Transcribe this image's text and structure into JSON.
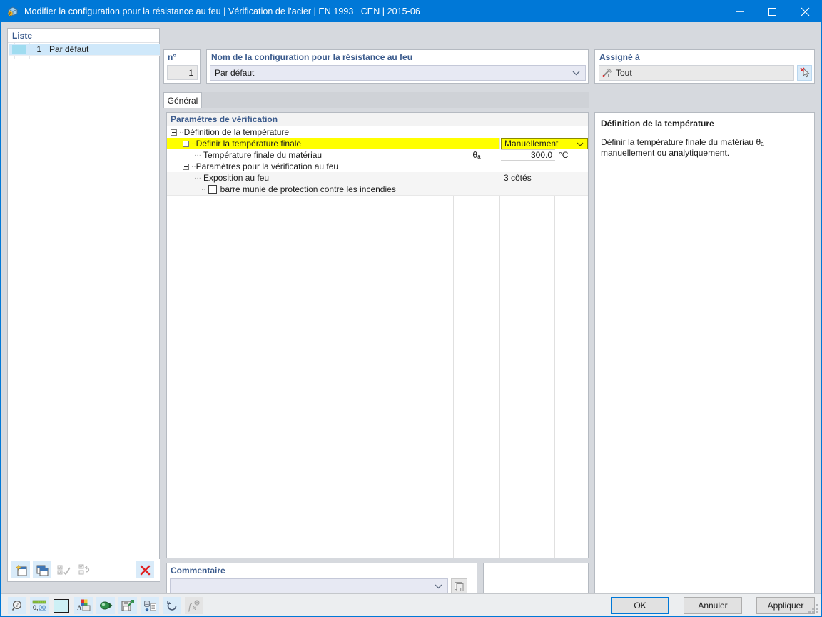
{
  "window": {
    "title": "Modifier la configuration pour la résistance au feu | Vérification de l'acier | EN 1993 | CEN | 2015-06",
    "icon": "app-fire-config-icon",
    "controls": {
      "minimize": "minimize-icon",
      "maximize": "maximize-icon",
      "close": "close-icon"
    }
  },
  "list_panel": {
    "header": "Liste",
    "rows": [
      {
        "number": "1",
        "name": "Par défaut",
        "swatch_color": "#9fdcf0",
        "selected": true
      }
    ],
    "toolbar": [
      {
        "name": "new-configuration-button",
        "icon": "new-page-icon",
        "enabled": true
      },
      {
        "name": "duplicate-configuration-button",
        "icon": "copy-page-icon",
        "enabled": true
      },
      {
        "name": "select-all-button",
        "icon": "check-all-icon",
        "enabled": false
      },
      {
        "name": "invert-selection-button",
        "icon": "invert-selection-icon",
        "enabled": false
      },
      {
        "name": "delete-configuration-button",
        "icon": "red-x-icon",
        "enabled": true
      }
    ]
  },
  "number_panel": {
    "header": "n°",
    "value": "1"
  },
  "name_panel": {
    "header": "Nom de la configuration pour la résistance au feu",
    "value": "Par défaut",
    "dropdown_icon": "chevron-down-icon"
  },
  "assigned_panel": {
    "header": "Assigné à",
    "value": "Tout",
    "value_icon": "member-select-icon",
    "pick_button_icon": "pick-cursor-icon"
  },
  "tabs": [
    {
      "label": "Général",
      "active": true
    }
  ],
  "tree": {
    "caption": "Paramètres de vérification",
    "rows": [
      {
        "indent": 0,
        "toggle": "minus",
        "label": "Définition de la température",
        "symbol": "",
        "value": "",
        "unit": "",
        "row_bg": "white",
        "kind": "group"
      },
      {
        "indent": 1,
        "toggle": "minus",
        "label": "Définir la température finale",
        "symbol": "",
        "value": "Manuellement",
        "unit": "",
        "row_bg": "highlight",
        "kind": "combo",
        "highlight_color": "#ffff00"
      },
      {
        "indent": 2,
        "toggle": "leaf",
        "label": "Température finale du matériau",
        "symbol": "θₐ",
        "value": "300.0",
        "unit": "°C",
        "row_bg": "white",
        "kind": "input"
      },
      {
        "indent": 1,
        "toggle": "minus",
        "label": "Paramètres pour la vérification au feu",
        "symbol": "",
        "value": "",
        "unit": "",
        "row_bg": "white",
        "kind": "group"
      },
      {
        "indent": 2,
        "toggle": "leaf",
        "label": "Exposition au feu",
        "symbol": "",
        "value": "3 côtés",
        "unit": "",
        "row_bg": "gray",
        "kind": "text"
      },
      {
        "indent": 3,
        "toggle": "checkbox",
        "label": "barre munie de protection contre les incendies",
        "symbol": "",
        "value": "",
        "unit": "",
        "row_bg": "gray",
        "kind": "checkbox",
        "checked": false
      }
    ]
  },
  "description": {
    "title": "Définition de la température",
    "text": "Définir la température finale du matériau θₐ manuellement ou analytiquement."
  },
  "comment_panel": {
    "header": "Commentaire",
    "value": "",
    "dropdown_icon": "chevron-down-icon",
    "library_button_icon": "comment-library-icon"
  },
  "status_bar": {
    "icons": [
      {
        "name": "info-query-button",
        "icon": "magnifier-info-icon",
        "enabled": true
      },
      {
        "name": "decimal-places-button",
        "icon": "decimal-0-00-icon",
        "enabled": true
      },
      {
        "name": "color-swatch-button",
        "icon": "color-swatch-icon",
        "color": "#cdf0f5",
        "enabled": true
      },
      {
        "name": "display-properties-button",
        "icon": "color-label-icon",
        "enabled": true
      },
      {
        "name": "render-button",
        "icon": "render-arrow-icon",
        "enabled": true
      },
      {
        "name": "save-settings-button",
        "icon": "save-arrow-icon",
        "enabled": true
      },
      {
        "name": "import-list-button",
        "icon": "list-import-icon",
        "enabled": true
      },
      {
        "name": "reset-button",
        "icon": "undo-circle-icon",
        "enabled": true
      },
      {
        "name": "formula-button",
        "icon": "fx-formula-icon",
        "enabled": false
      }
    ],
    "buttons": [
      {
        "label": "OK",
        "primary": true
      },
      {
        "label": "Annuler",
        "primary": false
      },
      {
        "label": "Appliquer",
        "primary": false
      }
    ],
    "resize_grip": "resize-grip-icon"
  }
}
